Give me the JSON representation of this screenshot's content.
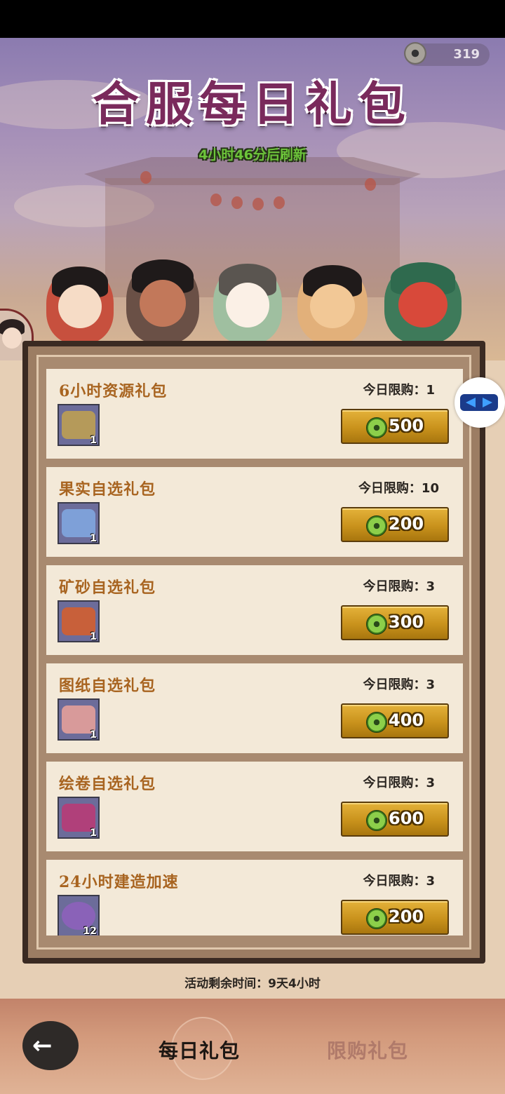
{
  "header": {
    "title": "合服每日礼包",
    "refresh_text": "4小时46分后刷新",
    "currency_amount": "319"
  },
  "packs": [
    {
      "name": "6小时资源礼包",
      "limit": "今日限购：1",
      "qty": "1",
      "price": "500",
      "icon": "resource-chest-icon"
    },
    {
      "name": "果实自选礼包",
      "limit": "今日限购：10",
      "qty": "1",
      "price": "200",
      "icon": "fruit-chest-icon"
    },
    {
      "name": "矿砂自选礼包",
      "limit": "今日限购：3",
      "qty": "1",
      "price": "300",
      "icon": "ore-bag-icon"
    },
    {
      "name": "图纸自选礼包",
      "limit": "今日限购：3",
      "qty": "1",
      "price": "400",
      "icon": "blueprint-bundle-icon"
    },
    {
      "name": "绘卷自选礼包",
      "limit": "今日限购：3",
      "qty": "1",
      "price": "600",
      "icon": "scroll-chest-icon"
    },
    {
      "name": "24小时建造加速",
      "limit": "今日限购：3",
      "qty": "12",
      "price": "200",
      "icon": "build-speedup-icon"
    }
  ],
  "footer": {
    "remaining": "活动剩余时间：9天4小时"
  },
  "tabs": {
    "daily": "每日礼包",
    "limited": "限购礼包"
  },
  "colors": {
    "accent_gold": "#c9921c",
    "title_purple": "#7a2a5c",
    "refresh_green": "#6cc43a",
    "pack_name": "#a86420"
  }
}
